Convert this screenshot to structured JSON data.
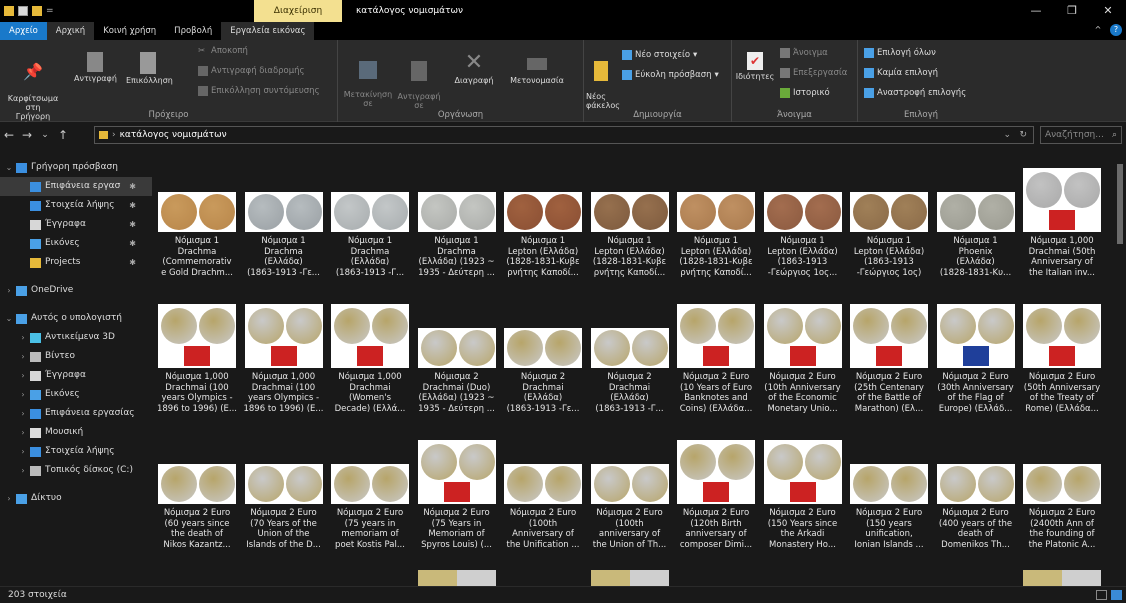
{
  "window": {
    "title": "κατάλογος νομισμάτων",
    "context_tab": "Διαχείριση",
    "qat_extra": "="
  },
  "ribbon_tabs": [
    "Αρχείο",
    "Αρχική",
    "Κοινή χρήση",
    "Προβολή",
    "Εργαλεία εικόνας"
  ],
  "ribbon": {
    "clipboard": {
      "label": "Πρόχειρο",
      "pin": "Καρφίτσωμα στη\nΓρήγορη πρόσβαση",
      "copy": "Αντιγραφή",
      "paste": "Επικόλληση",
      "cut": "Αποκοπή",
      "copy_path": "Αντιγραφή διαδρομής",
      "paste_shortcut": "Επικόλληση συντόμευσης"
    },
    "organize": {
      "label": "Οργάνωση",
      "move": "Μετακίνηση\nσε",
      "copyto": "Αντιγραφή\nσε",
      "delete": "Διαγραφή",
      "rename": "Μετονομασία"
    },
    "new": {
      "label": "Δημιουργία",
      "new_folder": "Νέος\nφάκελος",
      "new_item": "Νέο στοιχείο",
      "easy_access": "Εύκολη πρόσβαση"
    },
    "open": {
      "label": "Άνοιγμα",
      "properties": "Ιδιότητες",
      "open": "Άνοιγμα",
      "edit": "Επεξεργασία",
      "history": "Ιστορικό"
    },
    "select": {
      "label": "Επιλογή",
      "all": "Επιλογή όλων",
      "none": "Καμία επιλογή",
      "invert": "Αναστροφή επιλογής"
    }
  },
  "address": {
    "path": "κατάλογος νομισμάτων",
    "search_placeholder": "Αναζήτηση..."
  },
  "nav": [
    {
      "label": "Γρήγορη πρόσβαση",
      "icon": "star-icon",
      "color": "#3b8fe0",
      "chev": "⌄",
      "indent": 0
    },
    {
      "label": "Επιφάνεια εργασ",
      "icon": "desktop-icon",
      "color": "#3b8fe0",
      "chev": "",
      "indent": 1,
      "pin": true,
      "sel": true
    },
    {
      "label": "Στοιχεία λήψης",
      "icon": "download-icon",
      "color": "#3b8fe0",
      "chev": "",
      "indent": 1,
      "pin": true
    },
    {
      "label": "Έγγραφα",
      "icon": "documents-icon",
      "color": "#d7d7d7",
      "chev": "",
      "indent": 1,
      "pin": true
    },
    {
      "label": "Εικόνες",
      "icon": "pictures-icon",
      "color": "#4aa0e6",
      "chev": "",
      "indent": 1,
      "pin": true
    },
    {
      "label": "Projects",
      "icon": "folder-icon",
      "color": "#e6b93a",
      "chev": "",
      "indent": 1,
      "pin": true
    },
    {
      "label": "",
      "icon": "",
      "color": "",
      "chev": "",
      "indent": 0
    },
    {
      "label": "OneDrive",
      "icon": "cloud-icon",
      "color": "#4aa0e6",
      "chev": "›",
      "indent": 0
    },
    {
      "label": "",
      "icon": "",
      "color": "",
      "chev": "",
      "indent": 0
    },
    {
      "label": "Αυτός ο υπολογιστή",
      "icon": "computer-icon",
      "color": "#4aa0e6",
      "chev": "⌄",
      "indent": 0
    },
    {
      "label": "Αντικείμενα 3D",
      "icon": "cube-icon",
      "color": "#4ac0e6",
      "chev": "›",
      "indent": 1
    },
    {
      "label": "Βίντεο",
      "icon": "video-icon",
      "color": "#bbbbbb",
      "chev": "›",
      "indent": 1
    },
    {
      "label": "Έγγραφα",
      "icon": "documents-icon",
      "color": "#d7d7d7",
      "chev": "›",
      "indent": 1
    },
    {
      "label": "Εικόνες",
      "icon": "pictures-icon",
      "color": "#4aa0e6",
      "chev": "›",
      "indent": 1
    },
    {
      "label": "Επιφάνεια εργασίας",
      "icon": "desktop-icon",
      "color": "#3b8fe0",
      "chev": "›",
      "indent": 1
    },
    {
      "label": "Μουσική",
      "icon": "music-icon",
      "color": "#dddddd",
      "chev": "›",
      "indent": 1
    },
    {
      "label": "Στοιχεία λήψης",
      "icon": "download-icon",
      "color": "#3b8fe0",
      "chev": "›",
      "indent": 1
    },
    {
      "label": "Τοπικός δίσκος (C:)",
      "icon": "drive-icon",
      "color": "#bbbbbb",
      "chev": "›",
      "indent": 1
    },
    {
      "label": "",
      "icon": "",
      "color": "",
      "chev": "",
      "indent": 0
    },
    {
      "label": "Δίκτυο",
      "icon": "network-icon",
      "color": "#4aa0e6",
      "chev": "›",
      "indent": 0
    }
  ],
  "files": [
    [
      "Νόμισμα 1\nDrachma\n(Commemorativ\ne Gold Drachm...",
      "Νόμισμα 1\nDrachma\n(Ελλάδα)\n(1863-1913 -Γε...",
      "Νόμισμα 1\nDrachma\n(Ελλάδα)\n(1863-1913 -Γ...",
      "Νόμισμα 1\nDrachma\n(Ελλάδα) (1923 ~\n1935 - Δεύτερη ...",
      "Νόμισμα 1\nLepton (Ελλάδα)\n(1828-1831-Κυβε\nρνήτης Καποδί...",
      "Νόμισμα 1\nLepton (Ελλάδα)\n(1828-1831-Κυβε\nρνήτης Καποδί...",
      "Νόμισμα 1\nLepton (Ελλάδα)\n(1828-1831-Κυβε\nρνήτης Καποδί...",
      "Νόμισμα 1\nLepton (Ελλάδα)\n(1863-1913\n-Γεώργιος 1ος...",
      "Νόμισμα 1\nLepton (Ελλάδα)\n(1863-1913\n-Γεώργιος 1ος)",
      "Νόμισμα 1\nPhoenix\n(Ελλάδα)\n(1828-1831-Κυ...",
      "Νόμισμα 1,000\nDrachmai (50th\nAnniversary of\nthe Italian inv..."
    ],
    [
      "Νόμισμα 1,000\nDrachmai (100\nyears Olympics -\n1896 to 1996) (E...",
      "Νόμισμα 1,000\nDrachmai (100\nyears Olympics -\n1896 to 1996) (E...",
      "Νόμισμα 1,000\nDrachmai\n(Women's\nDecade) (Ελλά...",
      "Νόμισμα 2\nDrachmai (Duo)\n(Ελλάδα) (1923 ~\n1935 - Δεύτερη ...",
      "Νόμισμα 2\nDrachmai\n(Ελλάδα)\n(1863-1913 -Γε...",
      "Νόμισμα 2\nDrachmai\n(Ελλάδα)\n(1863-1913 -Γ...",
      "Νόμισμα 2 Euro\n(10 Years of Euro\nBanknotes and\nCoins) (Ελλάδα...",
      "Νόμισμα 2 Euro\n(10th Anniversary\nof the Economic\nMonetary Unio...",
      "Νόμισμα 2 Euro\n(25th Centenary\nof the Battle of\nMarathon) (Ελ...",
      "Νόμισμα 2 Euro\n(30th Anniversary\nof the Flag of\nEurope) (Ελλάδ...",
      "Νόμισμα 2 Euro\n(50th Anniversary\nof the Treaty of\nRome) (Ελλάδα..."
    ],
    [
      "Νόμισμα 2 Euro\n(60 years since\nthe death of\nNikos Kazantz...",
      "Νόμισμα 2 Euro\n(70 Years of the\nUnion of the\nIslands of the D...",
      "Νόμισμα 2 Euro\n(75 years in\nmemoriam of\npoet Kostis Pal...",
      "Νόμισμα 2 Euro\n(75 Years in\nMemoriam of\nSpyros Louis) (...",
      "Νόμισμα 2 Euro\n(100th\nAnniversary of\nthe Unification ...",
      "Νόμισμα 2 Euro\n(100th\nanniversary of\nthe Union of Th...",
      "Νόμισμα 2 Euro\n(120th Birth\nanniversary of\ncomposer Dimi...",
      "Νόμισμα 2 Euro\n(150 Years since\nthe Arkadi\nMonastery Ho...",
      "Νόμισμα 2 Euro\n(150 years\nunification,\nIonian Islands ...",
      "Νόμισμα 2 Euro\n(400 years of the\ndeath of\nDomenikos Th...",
      "Νόμισμα 2 Euro\n(2400th Ann of\nthe founding of\nthe Platonic A..."
    ]
  ],
  "status": {
    "count": "203 στοιχεία"
  },
  "colors": {
    "accent": "#1979ca",
    "selection": "#3a3a3a",
    "background": "#191919"
  }
}
